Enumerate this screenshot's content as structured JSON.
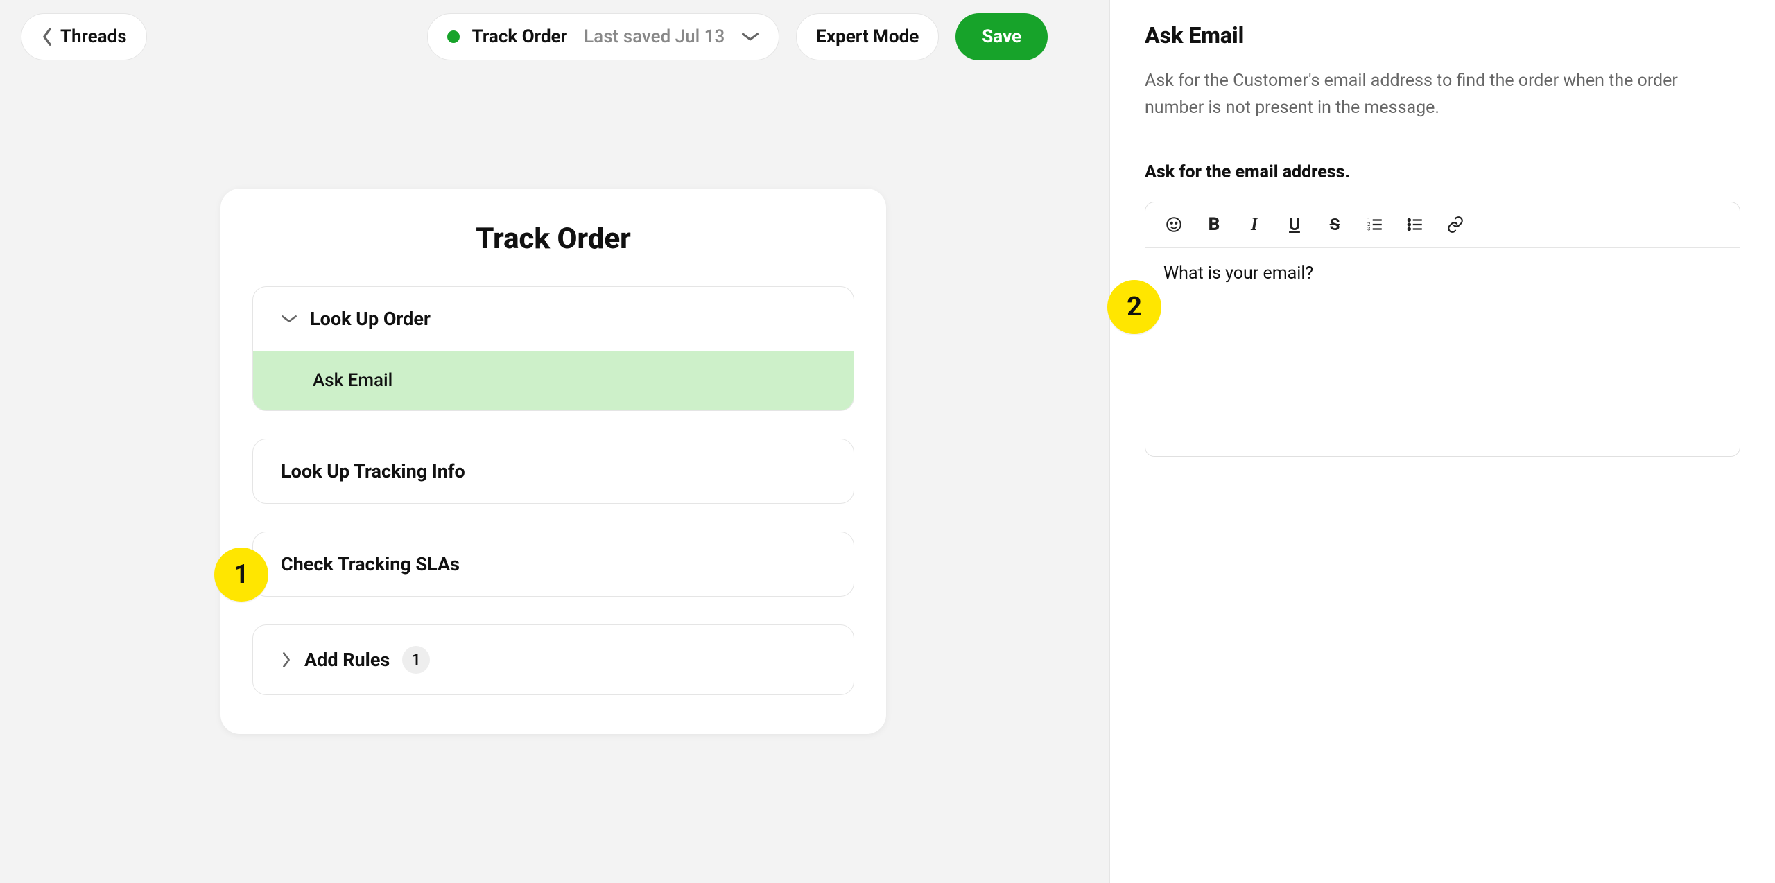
{
  "topbar": {
    "threads_label": "Threads",
    "doc_title": "Track Order",
    "last_saved": "Last saved Jul 13",
    "expert_label": "Expert Mode",
    "save_label": "Save"
  },
  "flow": {
    "title": "Track Order",
    "steps": [
      {
        "label": "Look Up Order",
        "expanded": true,
        "children": [
          {
            "label": "Ask Email",
            "selected": true
          }
        ]
      },
      {
        "label": "Look Up Tracking Info"
      },
      {
        "label": "Check Tracking SLAs"
      },
      {
        "label": "Add Rules",
        "count": "1",
        "chev": "right"
      }
    ]
  },
  "panel": {
    "title": "Ask Email",
    "description": "Ask for the Customer's email address to find the order when the order number is not present in the message.",
    "subhead": "Ask for the email address.",
    "body": "What is your email?"
  },
  "annotations": {
    "one": "1",
    "two": "2"
  },
  "colors": {
    "accent": "#17a32a",
    "highlight": "#cdf0c9",
    "annot": "#ffe600"
  }
}
